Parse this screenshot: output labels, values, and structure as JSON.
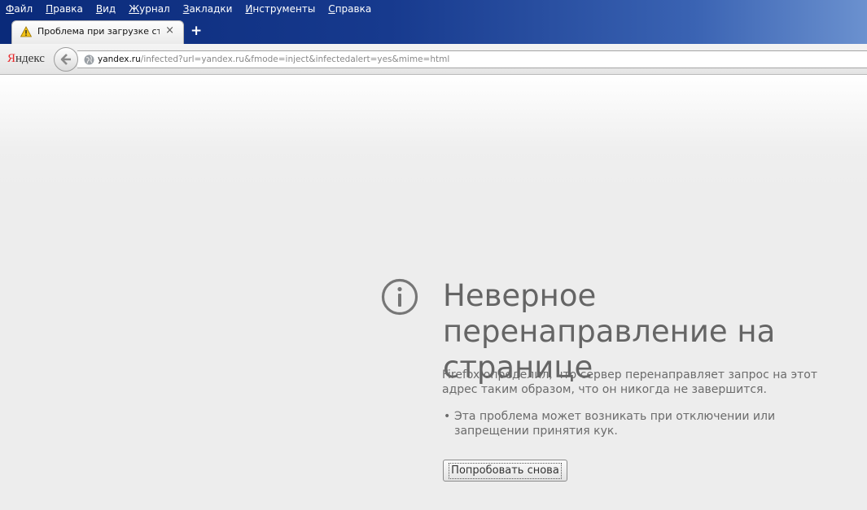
{
  "menu": {
    "items": [
      {
        "accel": "Ф",
        "rest": "айл"
      },
      {
        "accel": "П",
        "rest": "равка"
      },
      {
        "accel": "В",
        "rest": "ид"
      },
      {
        "accel": "Ж",
        "rest": "урнал"
      },
      {
        "accel": "З",
        "rest": "акладки"
      },
      {
        "accel": "И",
        "rest": "нструменты"
      },
      {
        "accel": "С",
        "rest": "правка"
      }
    ]
  },
  "tab": {
    "title": "Проблема при загрузке стр...",
    "close_glyph": "×",
    "icon": "warning-icon"
  },
  "new_tab_glyph": "+",
  "toolbar": {
    "brand_first": "Я",
    "brand_rest": "ндекс",
    "url_host": "yandex.ru",
    "url_path": "/infected?url=yandex.ru&fmode=inject&infectedalert=yes&mime=html"
  },
  "error": {
    "title": "Неверное перенаправление на странице",
    "description": "Firefox определил, что сервер перенаправляет запрос на этот адрес таким образом, что он никогда не завершится.",
    "bullet": "Эта проблема может возникать при отключении или запрещении принятия кук.",
    "retry_label": "Попробовать снова"
  },
  "colors": {
    "titlebar": "#173a8e",
    "content_bg": "#ededed",
    "title_text": "#656565",
    "brand_accent": "#e8262a"
  }
}
